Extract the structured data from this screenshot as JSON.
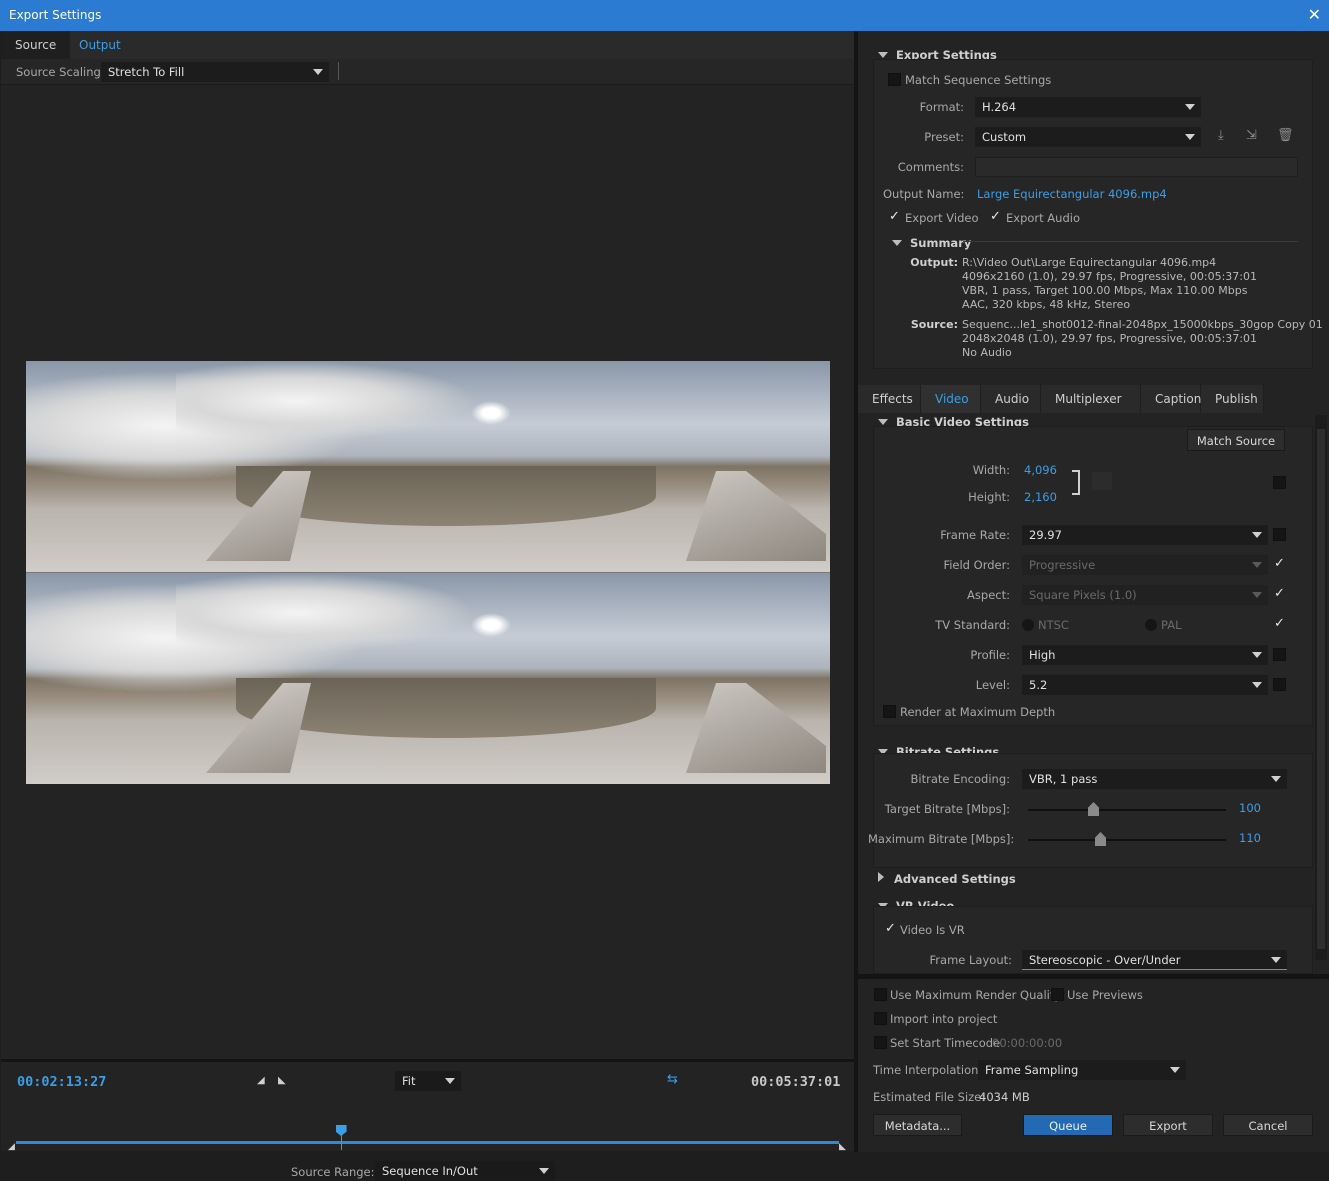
{
  "window": {
    "title": "Export Settings"
  },
  "left_tabs": [
    {
      "label": "Source"
    },
    {
      "label": "Output"
    }
  ],
  "source_scaling": {
    "label": "Source Scaling:",
    "value": "Stretch To Fill"
  },
  "timeline": {
    "current_time": "00:02:13:27",
    "duration": "00:05:37:01",
    "zoom": "Fit",
    "source_range_label": "Source Range:",
    "source_range_value": "Sequence In/Out",
    "playhead_fraction": 0.395
  },
  "export_settings": {
    "header": "Export Settings",
    "match_sequence": "Match Sequence Settings",
    "format_label": "Format:",
    "format_value": "H.264",
    "preset_label": "Preset:",
    "preset_value": "Custom",
    "comments_label": "Comments:",
    "output_name_label": "Output Name:",
    "output_name_value": "Large Equirectangular 4096.mp4",
    "export_video": "Export Video",
    "export_audio": "Export Audio"
  },
  "summary": {
    "header": "Summary",
    "output_label": "Output:",
    "output_lines": [
      "R:\\Video Out\\Large Equirectangular 4096.mp4",
      "4096x2160 (1.0), 29.97 fps, Progressive, 00:05:37:01",
      "VBR, 1 pass, Target 100.00 Mbps, Max 110.00 Mbps",
      "AAC, 320 kbps, 48 kHz, Stereo"
    ],
    "source_label": "Source:",
    "source_lines": [
      "Sequenc...le1_shot0012-final-2048px_15000kbps_30gop Copy 01",
      "2048x2048 (1.0), 29.97 fps, Progressive, 00:05:37:01",
      "No Audio"
    ]
  },
  "settings_tabs": [
    {
      "label": "Effects"
    },
    {
      "label": "Video"
    },
    {
      "label": "Audio"
    },
    {
      "label": "Multiplexer"
    },
    {
      "label": "Captions"
    },
    {
      "label": "Publish"
    }
  ],
  "basic_video": {
    "header": "Basic Video Settings",
    "match_source": "Match Source",
    "width_label": "Width:",
    "width_value": "4,096",
    "height_label": "Height:",
    "height_value": "2,160",
    "frame_rate_label": "Frame Rate:",
    "frame_rate_value": "29.97",
    "field_order_label": "Field Order:",
    "field_order_value": "Progressive",
    "aspect_label": "Aspect:",
    "aspect_value": "Square Pixels (1.0)",
    "tv_standard_label": "TV Standard:",
    "ntsc": "NTSC",
    "pal": "PAL",
    "profile_label": "Profile:",
    "profile_value": "High",
    "level_label": "Level:",
    "level_value": "5.2",
    "max_depth": "Render at Maximum Depth"
  },
  "bitrate": {
    "header": "Bitrate Settings",
    "encoding_label": "Bitrate Encoding:",
    "encoding_value": "VBR, 1 pass",
    "target_label": "Target Bitrate [Mbps]:",
    "target_value": "100",
    "max_label": "Maximum Bitrate [Mbps]:",
    "max_value": "110"
  },
  "advanced": {
    "header": "Advanced Settings"
  },
  "vr": {
    "header": "VR Video",
    "is_vr": "Video Is VR",
    "layout_label": "Frame Layout:",
    "layout_value": "Stereoscopic - Over/Under"
  },
  "bottom": {
    "max_render": "Use Maximum Render Quality",
    "use_previews": "Use Previews",
    "import_project": "Import into project",
    "start_tc": "Set Start Timecode",
    "start_tc_value": "00:00:00:00",
    "time_interp_label": "Time Interpolation:",
    "time_interp_value": "Frame Sampling",
    "file_size_label": "Estimated File Size:",
    "file_size_value": "4034 MB",
    "metadata": "Metadata...",
    "queue": "Queue",
    "export": "Export",
    "cancel": "Cancel"
  }
}
